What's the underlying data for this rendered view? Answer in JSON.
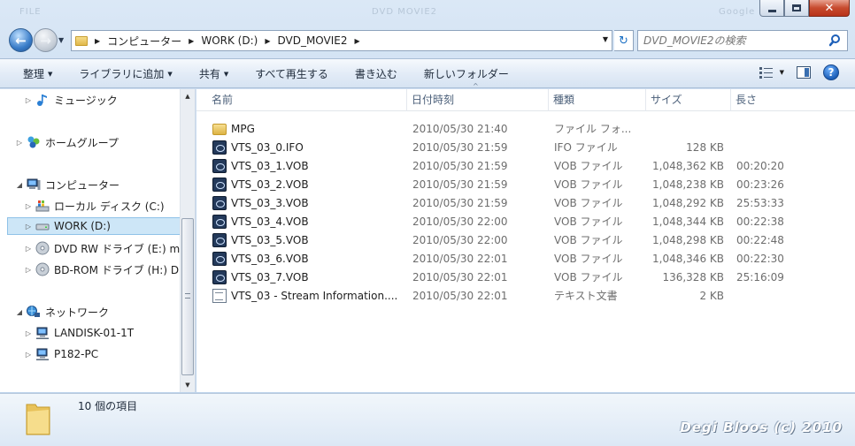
{
  "window": {
    "ghost_title_left": "FILE",
    "ghost_title_mid": "DVD MOVIE2",
    "ghost_title_right": "Google",
    "close_glyph": "✕"
  },
  "nav": {
    "back_glyph": "←",
    "forward_glyph": "→",
    "history_drop": "▼",
    "breadcrumbs": [
      "コンピューター",
      "WORK (D:)",
      "DVD_MOVIE2"
    ],
    "sep": "▶",
    "addr_drop": "▼",
    "refresh_glyph": "↻",
    "search_placeholder": "DVD_MOVIE2の検索"
  },
  "toolbar": {
    "organize": "整理",
    "add_to_library": "ライブラリに追加",
    "share": "共有",
    "play_all": "すべて再生する",
    "burn": "書き込む",
    "new_folder": "新しいフォルダー",
    "drop_glyph": "▼",
    "help_glyph": "?"
  },
  "tree": {
    "expand_closed": "▷",
    "expand_open": "◢",
    "items": [
      {
        "label": "ミュージック",
        "icon": "music-icon"
      },
      {
        "label": "ホームグループ",
        "icon": "homegroup-icon"
      },
      {
        "label": "コンピューター",
        "icon": "computer-icon"
      },
      {
        "label": "ローカル ディスク (C:)",
        "icon": "local-disk-icon"
      },
      {
        "label": "WORK (D:)",
        "icon": "drive-icon"
      },
      {
        "label": "DVD RW ドライブ (E:) m",
        "icon": "dvd-drive-icon"
      },
      {
        "label": "BD-ROM ドライブ (H:) D'",
        "icon": "bd-drive-icon"
      },
      {
        "label": "ネットワーク",
        "icon": "network-icon"
      },
      {
        "label": "LANDISK-01-1T",
        "icon": "network-computer-icon"
      },
      {
        "label": "P182-PC",
        "icon": "network-computer-icon"
      }
    ],
    "scroll_up": "▲",
    "scroll_down": "▼"
  },
  "columns": {
    "name": "名前",
    "date": "日付時刻",
    "type": "種類",
    "size": "サイズ",
    "length": "長さ",
    "sort_glyph": "^"
  },
  "files": [
    {
      "name": "MPG",
      "date": "2010/05/30 21:40",
      "type": "ファイル フォ...",
      "size": "",
      "length": "",
      "icon": "folder-icon"
    },
    {
      "name": "VTS_03_0.IFO",
      "date": "2010/05/30 21:59",
      "type": "IFO ファイル",
      "size": "128 KB",
      "length": "",
      "icon": "vob-icon"
    },
    {
      "name": "VTS_03_1.VOB",
      "date": "2010/05/30 21:59",
      "type": "VOB ファイル",
      "size": "1,048,362 KB",
      "length": "00:20:20",
      "icon": "vob-icon"
    },
    {
      "name": "VTS_03_2.VOB",
      "date": "2010/05/30 21:59",
      "type": "VOB ファイル",
      "size": "1,048,238 KB",
      "length": "00:23:26",
      "icon": "vob-icon"
    },
    {
      "name": "VTS_03_3.VOB",
      "date": "2010/05/30 21:59",
      "type": "VOB ファイル",
      "size": "1,048,292 KB",
      "length": "25:53:33",
      "icon": "vob-icon"
    },
    {
      "name": "VTS_03_4.VOB",
      "date": "2010/05/30 22:00",
      "type": "VOB ファイル",
      "size": "1,048,344 KB",
      "length": "00:22:38",
      "icon": "vob-icon"
    },
    {
      "name": "VTS_03_5.VOB",
      "date": "2010/05/30 22:00",
      "type": "VOB ファイル",
      "size": "1,048,298 KB",
      "length": "00:22:48",
      "icon": "vob-icon"
    },
    {
      "name": "VTS_03_6.VOB",
      "date": "2010/05/30 22:01",
      "type": "VOB ファイル",
      "size": "1,048,346 KB",
      "length": "00:22:30",
      "icon": "vob-icon"
    },
    {
      "name": "VTS_03_7.VOB",
      "date": "2010/05/30 22:01",
      "type": "VOB ファイル",
      "size": "136,328 KB",
      "length": "25:16:09",
      "icon": "vob-icon"
    },
    {
      "name": "VTS_03 - Stream Information....",
      "date": "2010/05/30 22:01",
      "type": "テキスト文書",
      "size": "2 KB",
      "length": "",
      "icon": "text-file-icon"
    }
  ],
  "details": {
    "item_count": "10 個の項目"
  },
  "watermark": "Degi Bloos (c) 2010"
}
